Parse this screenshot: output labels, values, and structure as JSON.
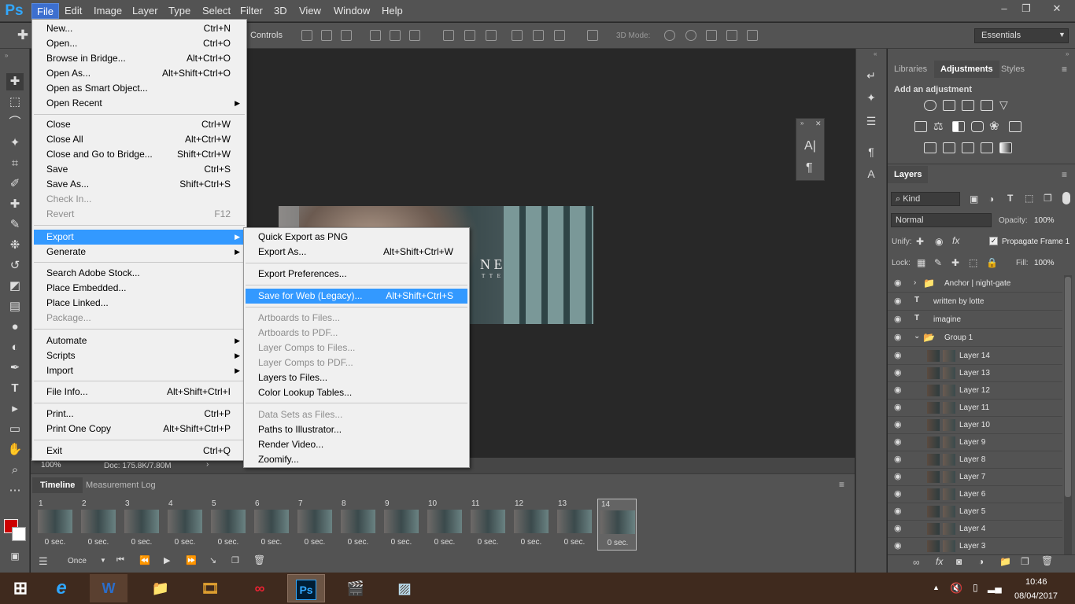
{
  "app": {
    "logo": "Ps"
  },
  "menubar": {
    "items": [
      "File",
      "Edit",
      "Image",
      "Layer",
      "Type",
      "Select",
      "Filter",
      "3D",
      "View",
      "Window",
      "Help"
    ]
  },
  "options_bar": {
    "controls_label": "Controls",
    "mode_3d": "3D Mode:",
    "workspace": "Essentials"
  },
  "document": {
    "zoom": "100%",
    "doc_info": "Doc: 175.8K/7.80M",
    "overlay_letters": "N   E",
    "overlay_small": "T T E"
  },
  "file_menu": {
    "items": [
      {
        "label": "New...",
        "shortcut": "Ctrl+N"
      },
      {
        "label": "Open...",
        "shortcut": "Ctrl+O"
      },
      {
        "label": "Browse in Bridge...",
        "shortcut": "Alt+Ctrl+O"
      },
      {
        "label": "Open As...",
        "shortcut": "Alt+Shift+Ctrl+O"
      },
      {
        "label": "Open as Smart Object...",
        "shortcut": ""
      },
      {
        "label": "Open Recent",
        "shortcut": ""
      },
      {
        "label": "Close",
        "shortcut": "Ctrl+W"
      },
      {
        "label": "Close All",
        "shortcut": "Alt+Ctrl+W"
      },
      {
        "label": "Close and Go to Bridge...",
        "shortcut": "Shift+Ctrl+W"
      },
      {
        "label": "Save",
        "shortcut": "Ctrl+S"
      },
      {
        "label": "Save As...",
        "shortcut": "Shift+Ctrl+S"
      },
      {
        "label": "Check In...",
        "shortcut": ""
      },
      {
        "label": "Revert",
        "shortcut": "F12"
      },
      {
        "label": "Export",
        "shortcut": ""
      },
      {
        "label": "Generate",
        "shortcut": ""
      },
      {
        "label": "Search Adobe Stock...",
        "shortcut": ""
      },
      {
        "label": "Place Embedded...",
        "shortcut": ""
      },
      {
        "label": "Place Linked...",
        "shortcut": ""
      },
      {
        "label": "Package...",
        "shortcut": ""
      },
      {
        "label": "Automate",
        "shortcut": ""
      },
      {
        "label": "Scripts",
        "shortcut": ""
      },
      {
        "label": "Import",
        "shortcut": ""
      },
      {
        "label": "File Info...",
        "shortcut": "Alt+Shift+Ctrl+I"
      },
      {
        "label": "Print...",
        "shortcut": "Ctrl+P"
      },
      {
        "label": "Print One Copy",
        "shortcut": "Alt+Shift+Ctrl+P"
      },
      {
        "label": "Exit",
        "shortcut": "Ctrl+Q"
      }
    ]
  },
  "export_menu": {
    "items": [
      {
        "label": "Quick Export as PNG",
        "shortcut": ""
      },
      {
        "label": "Export As...",
        "shortcut": "Alt+Shift+Ctrl+W"
      },
      {
        "label": "Export Preferences...",
        "shortcut": ""
      },
      {
        "label": "Save for Web (Legacy)...",
        "shortcut": "Alt+Shift+Ctrl+S"
      },
      {
        "label": "Artboards to Files...",
        "shortcut": ""
      },
      {
        "label": "Artboards to PDF...",
        "shortcut": ""
      },
      {
        "label": "Layer Comps to Files...",
        "shortcut": ""
      },
      {
        "label": "Layer Comps to PDF...",
        "shortcut": ""
      },
      {
        "label": "Layers to Files...",
        "shortcut": ""
      },
      {
        "label": "Color Lookup Tables...",
        "shortcut": ""
      },
      {
        "label": "Data Sets as Files...",
        "shortcut": ""
      },
      {
        "label": "Paths to Illustrator...",
        "shortcut": ""
      },
      {
        "label": "Render Video...",
        "shortcut": ""
      },
      {
        "label": "Zoomify...",
        "shortcut": ""
      }
    ]
  },
  "timeline": {
    "tabs": [
      "Timeline",
      "Measurement Log"
    ],
    "frames": [
      {
        "num": "1",
        "dur": "0 sec."
      },
      {
        "num": "2",
        "dur": "0 sec."
      },
      {
        "num": "3",
        "dur": "0 sec."
      },
      {
        "num": "4",
        "dur": "0 sec."
      },
      {
        "num": "5",
        "dur": "0 sec."
      },
      {
        "num": "6",
        "dur": "0 sec."
      },
      {
        "num": "7",
        "dur": "0 sec."
      },
      {
        "num": "8",
        "dur": "0 sec."
      },
      {
        "num": "9",
        "dur": "0 sec."
      },
      {
        "num": "10",
        "dur": "0 sec."
      },
      {
        "num": "11",
        "dur": "0 sec."
      },
      {
        "num": "12",
        "dur": "0 sec."
      },
      {
        "num": "13",
        "dur": "0 sec."
      },
      {
        "num": "14",
        "dur": "0 sec."
      }
    ],
    "loop": "Once"
  },
  "panels": {
    "tabs": [
      "Libraries",
      "Adjustments",
      "Styles"
    ],
    "add_adjustment": "Add an adjustment",
    "layers_tab": "Layers",
    "kind": "Kind",
    "blend": "Normal",
    "opacity_label": "Opacity:",
    "opacity": "100%",
    "unify": "Unify:",
    "propagate": "Propagate Frame 1",
    "lock": "Lock:",
    "fill_label": "Fill:",
    "fill": "100%"
  },
  "layers": [
    {
      "name": "Anchor | night-gate",
      "type": "group"
    },
    {
      "name": "written by lotte",
      "type": "text"
    },
    {
      "name": "imagine",
      "type": "text"
    },
    {
      "name": "Group 1",
      "type": "group"
    },
    {
      "name": "Layer 14",
      "type": "pixel"
    },
    {
      "name": "Layer 13",
      "type": "pixel"
    },
    {
      "name": "Layer 12",
      "type": "pixel"
    },
    {
      "name": "Layer 11",
      "type": "pixel"
    },
    {
      "name": "Layer 10",
      "type": "pixel"
    },
    {
      "name": "Layer 9",
      "type": "pixel"
    },
    {
      "name": "Layer 8",
      "type": "pixel"
    },
    {
      "name": "Layer 7",
      "type": "pixel"
    },
    {
      "name": "Layer 6",
      "type": "pixel"
    },
    {
      "name": "Layer 5",
      "type": "pixel"
    },
    {
      "name": "Layer 4",
      "type": "pixel"
    },
    {
      "name": "Layer 3",
      "type": "pixel"
    }
  ],
  "taskbar": {
    "time": "10:46",
    "date": "08/04/2017"
  },
  "colors": {
    "accent": "#3399ff",
    "menu_bg": "#f0f0f0",
    "ui_bg": "#535353",
    "foreground": "#cc0000"
  }
}
